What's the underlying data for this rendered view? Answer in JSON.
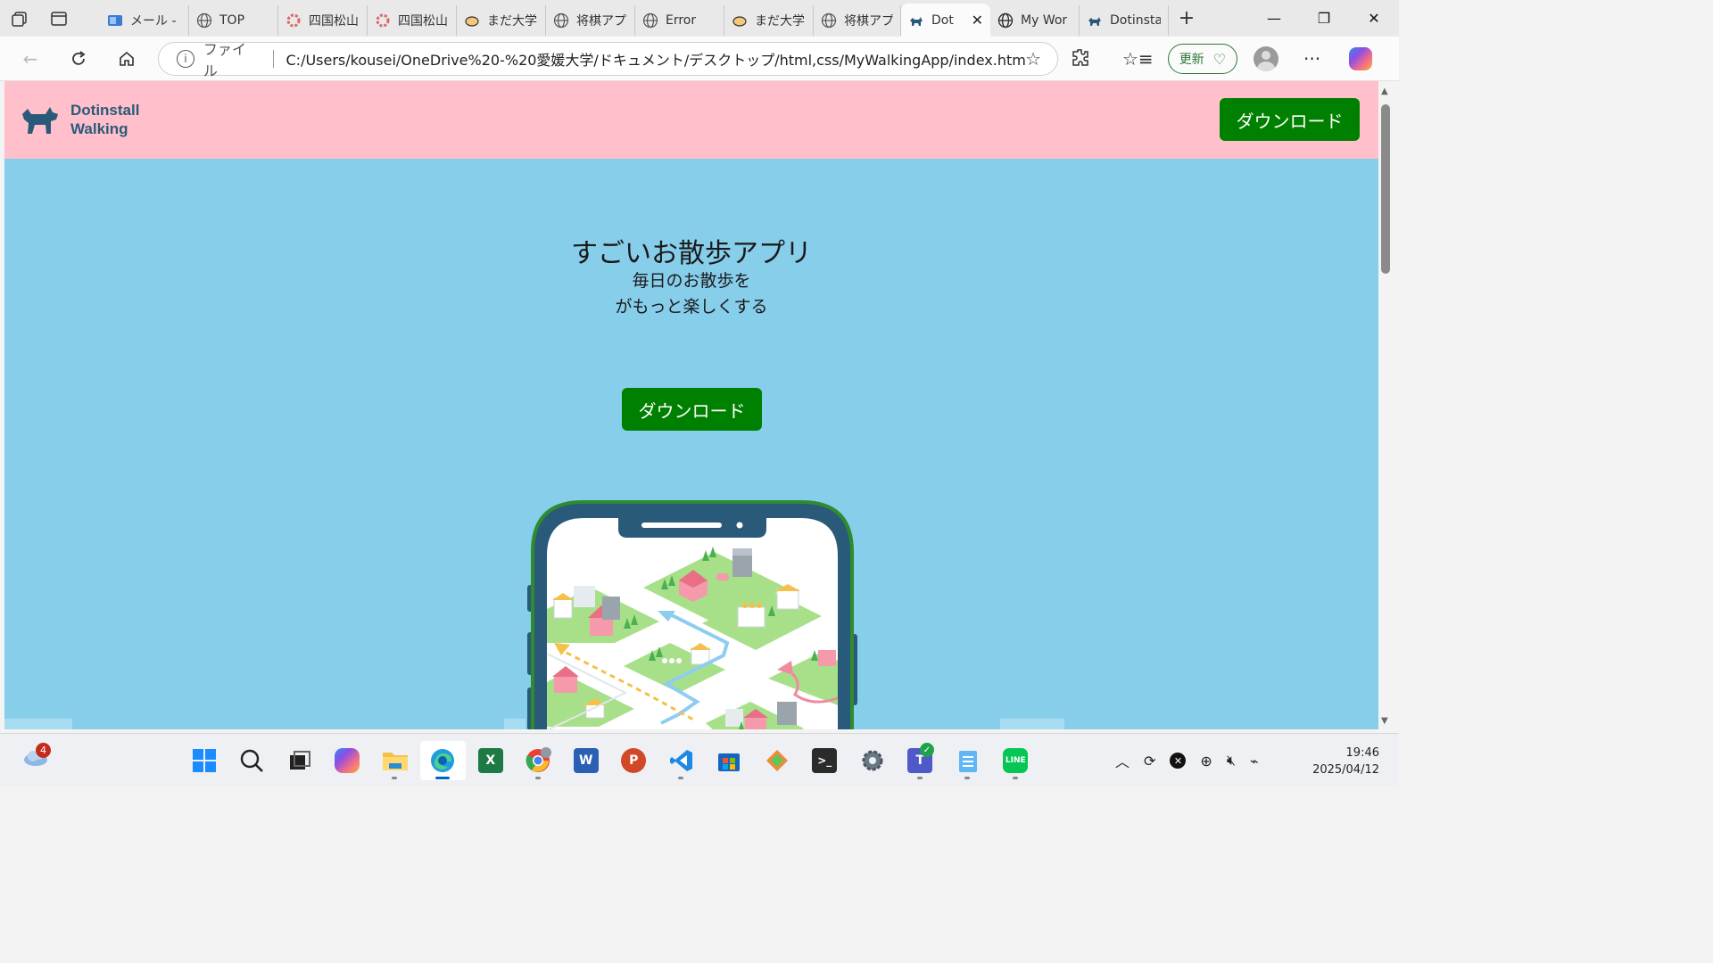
{
  "browser": {
    "tabs": [
      {
        "title": "",
        "icon": "workspaces-icon"
      },
      {
        "title": "メール - U",
        "icon": "outlook-icon"
      },
      {
        "title": "TOP",
        "icon": "globe-icon"
      },
      {
        "title": "四国松山",
        "icon": "pinwheel-icon"
      },
      {
        "title": "四国松山",
        "icon": "pinwheel-icon"
      },
      {
        "title": "まだ大学",
        "icon": "bowl-icon"
      },
      {
        "title": "将棋アプ",
        "icon": "globe-icon"
      },
      {
        "title": "Error",
        "icon": "globe-icon"
      },
      {
        "title": "まだ大学",
        "icon": "bowl-icon"
      },
      {
        "title": "将棋アプ",
        "icon": "globe-icon"
      },
      {
        "title": "Dot",
        "icon": "dog-icon",
        "active": true
      },
      {
        "title": "My Wor",
        "icon": "globe-icon"
      },
      {
        "title": "Dotinsta",
        "icon": "dog-icon"
      }
    ],
    "address": {
      "scheme_label": "ファイル",
      "url": "C:/Users/kousei/OneDrive%20-%20愛媛大学/ドキュメント/デスクトップ/html,css/MyWalkingApp/index.html"
    },
    "update_label": "更新"
  },
  "page": {
    "logo_line1": "Dotinstall",
    "logo_line2": "Walking",
    "header_download": "ダウンロード",
    "hero_title": "すごいお散歩アプリ",
    "hero_sub1": "毎日のお散歩を",
    "hero_sub2": "がもっと楽しくする",
    "main_download": "ダウンロード",
    "colors": {
      "header_bg": "#ffc0cb",
      "body_bg": "#87ceeb",
      "button_bg": "#008000"
    }
  },
  "taskbar": {
    "weather_badge": "4",
    "apps": [
      "start-icon",
      "search-icon",
      "task-view-icon",
      "copilot-icon",
      "file-explorer-icon",
      "edge-icon",
      "excel-icon",
      "chrome-icon",
      "word-icon",
      "powerpoint-icon",
      "vscode-icon",
      "store-icon",
      "git-icon",
      "terminal-icon",
      "settings-icon",
      "teams-icon",
      "notepad-icon",
      "line-icon"
    ],
    "time": "19:46",
    "date": "2025/04/12"
  }
}
